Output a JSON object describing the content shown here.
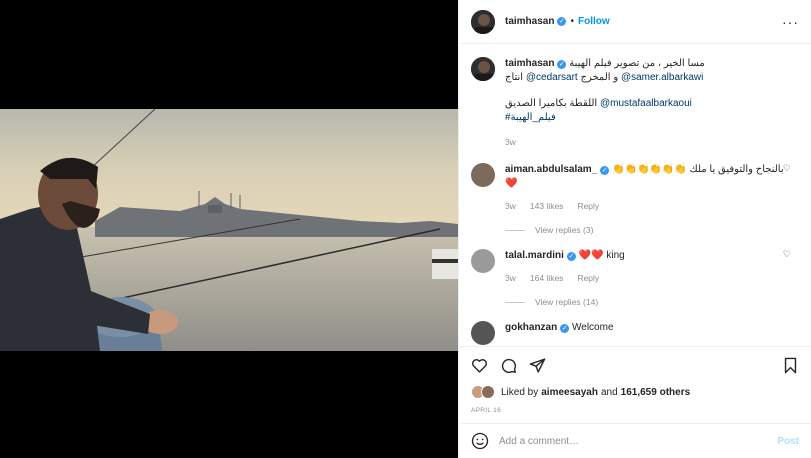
{
  "header": {
    "username": "taimhasan",
    "dot": "•",
    "follow_label": "Follow",
    "more_icon": "more-icon"
  },
  "caption": {
    "username": "taimhasan",
    "line1": "مسا الخير ، من تصوير فيلم الهيبة",
    "line2_pre": "انتاج ",
    "mention1": "@cedarsart",
    "line2_mid": " و المخرج ",
    "mention2": "@samer.albarkawi",
    "line3_pre": "اللقطة بكاميرا الصديق ",
    "mention3": "@mustafaalbarkaoui",
    "hashtag": "#فيلم_الهيبة",
    "time": "3w"
  },
  "comments": [
    {
      "username": "aiman.abdulsalam_",
      "text": "بالنجاح والتوفيق يا ملك",
      "emoji": "👏👏👏👏👏👏",
      "emoji2": "❤️",
      "time": "3w",
      "likes": "143 likes",
      "reply": "Reply",
      "view_replies": "View replies (3)"
    },
    {
      "username": "talal.mardini",
      "emoji": "❤️❤️",
      "text": " king",
      "time": "3w",
      "likes": "164 likes",
      "reply": "Reply",
      "view_replies": "View replies (14)"
    },
    {
      "username": "gokhanzan",
      "text": "Welcome"
    }
  ],
  "likes": {
    "prefix": "Liked by ",
    "user": "aimeesayah",
    "mid": " and ",
    "count": "161,659 others"
  },
  "date": "APRIL 16",
  "add_comment": {
    "placeholder": "Add a comment…",
    "post_label": "Post"
  },
  "colors": {
    "accent": "#0095f6",
    "link": "#00376b",
    "muted": "#8e8e8e",
    "heart": "#ed4956"
  }
}
